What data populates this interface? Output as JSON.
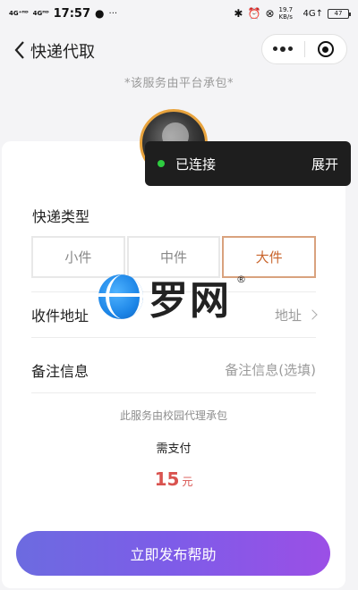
{
  "status_bar": {
    "signal_1": "4G⁺ᴴᴰ",
    "signal_2": "4Gᴴᴰ",
    "time": "17:57",
    "net_speed": "19.7 KB/s",
    "net_type": "4G↑",
    "battery": "47"
  },
  "nav": {
    "title": "快递代取"
  },
  "notice": "*该服务由平台承包*",
  "toast": {
    "status": "已连接",
    "action": "展开"
  },
  "form": {
    "type_title": "快递类型",
    "options": [
      "小件",
      "中件",
      "大件"
    ],
    "selected_option": "大件",
    "address_label": "收件地址",
    "address_value": "地址",
    "remark_label": "备注信息",
    "remark_placeholder": "备注信息(选填)"
  },
  "service_note": "此服务由校园代理承包",
  "payment": {
    "label": "需支付",
    "amount": "15",
    "unit": "元"
  },
  "submit_label": "立即发布帮助",
  "watermark": {
    "text": "罗网",
    "reg": "®"
  },
  "colors": {
    "accent": "#c9652c",
    "price": "#d9534f",
    "button_start": "#6c6be0",
    "button_end": "#9b4fe6",
    "connected_dot": "#2ecc40"
  }
}
